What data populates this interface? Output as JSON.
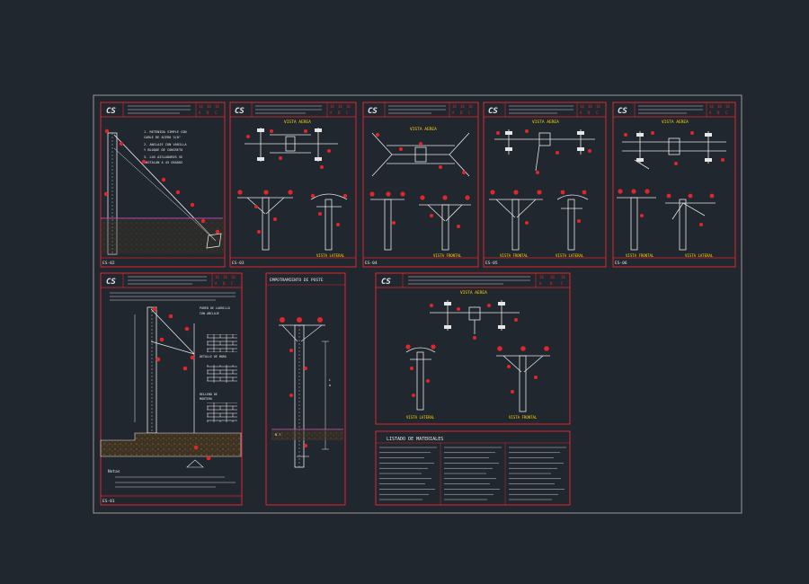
{
  "colors": {
    "background": "#21272f",
    "sheet_border": "#9a9a9a",
    "frame_red": "#e0262a",
    "drawing_white": "#e6e6e6",
    "label_yellow": "#ffd400",
    "ground_brown": "#5a4a2e",
    "highlight_magenta": "#d14bd1"
  },
  "panels": {
    "p1": {
      "logo": "CS",
      "code": "ES-02"
    },
    "p2": {
      "logo": "CS",
      "subtitle": "VISTA AEREA",
      "left_view": "",
      "right_view": "VISTA LATERAL",
      "code": "ES-03"
    },
    "p3": {
      "logo": "CS",
      "subtitle": "VISTA AEREA",
      "left_view": "",
      "right_view": "VISTA FRONTAL",
      "code": "ES-04"
    },
    "p4": {
      "logo": "CS",
      "subtitle": "VISTA AEREA",
      "left_view": "VISTA FRONTAL",
      "right_view": "VISTA LATERAL",
      "code": "ES-05"
    },
    "p5": {
      "logo": "CS",
      "subtitle": "VISTA AEREA",
      "left_view": "VISTA FRONTAL",
      "right_view": "VISTA LATERAL",
      "code": "ES-06"
    },
    "p6": {
      "logo": "CS",
      "note_title": "Notas",
      "code": "ES-01"
    },
    "p7": {
      "title": "EMPOTRAMIENTO DE POSTE"
    },
    "p8": {
      "logo": "CS",
      "subtitle": "VISTA AEREA",
      "left_view": "VISTA LATERAL",
      "right_view": "VISTA FRONTAL"
    },
    "materials": {
      "title": "LISTADO DE MATERIALES"
    }
  }
}
